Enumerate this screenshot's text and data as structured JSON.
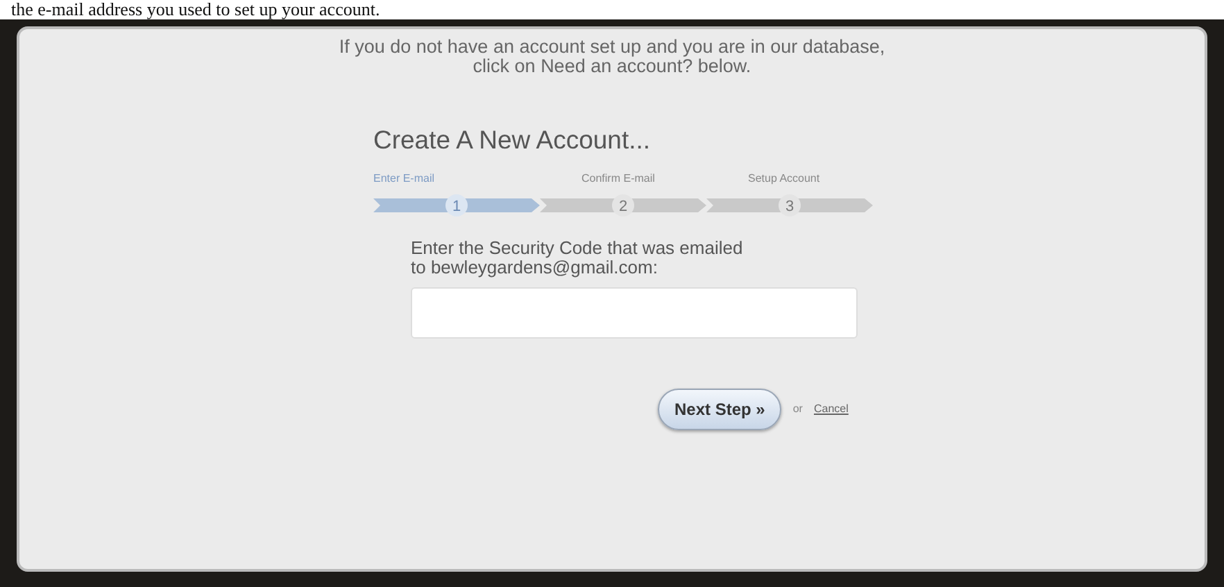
{
  "caption": "the e-mail address you used to set up your account.",
  "notice": [
    "If you do not have an account set up and you are in our database,",
    "click on Need an account? below."
  ],
  "heading": "Create A New Account...",
  "steps": [
    {
      "label": "Enter E-mail",
      "number": "1",
      "selected": true
    },
    {
      "label": "Confirm E-mail",
      "number": "2",
      "selected": false
    },
    {
      "label": "Setup Account",
      "number": "3",
      "selected": false
    }
  ],
  "prompt": [
    "Enter the Security Code that was emailed",
    "to bewleygardens@gmail.com:"
  ],
  "next_button": "Next Step",
  "next_icon": "»",
  "or_text": "or",
  "cancel_link": "Cancel"
}
